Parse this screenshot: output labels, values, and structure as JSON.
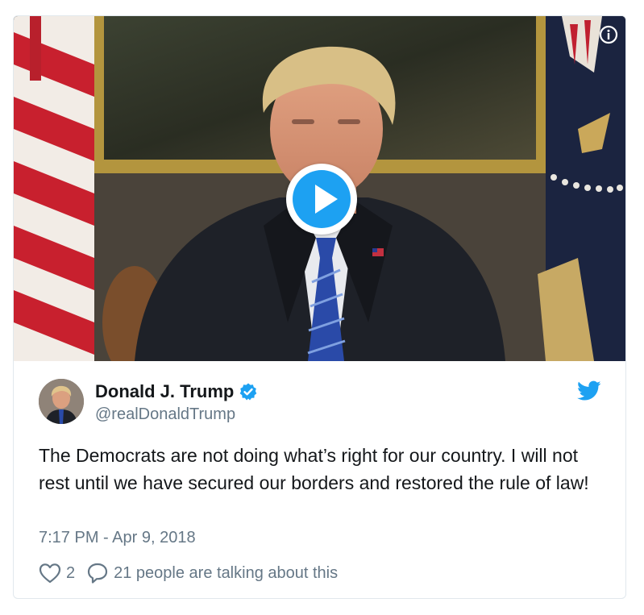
{
  "tweet": {
    "author": {
      "display_name": "Donald J. Trump",
      "handle": "@realDonaldTrump",
      "verified": true
    },
    "text": "The Democrats are not doing what’s right for our country. I will not rest until we have secured our borders and restored the rule of law!",
    "timestamp": "7:17 PM - Apr 9, 2018",
    "likes": "2",
    "conversation": "21 people are talking about this"
  },
  "media": {
    "type": "video",
    "play_icon": "play-icon",
    "info_icon": "info-icon"
  },
  "icons": {
    "brand": "twitter-bird-icon",
    "verified": "verified-badge-icon",
    "like": "heart-icon",
    "reply": "speech-bubble-icon"
  },
  "colors": {
    "accent": "#1da1f2",
    "text_primary": "#14171a",
    "text_secondary": "#657786",
    "border": "#e1e8ed"
  }
}
